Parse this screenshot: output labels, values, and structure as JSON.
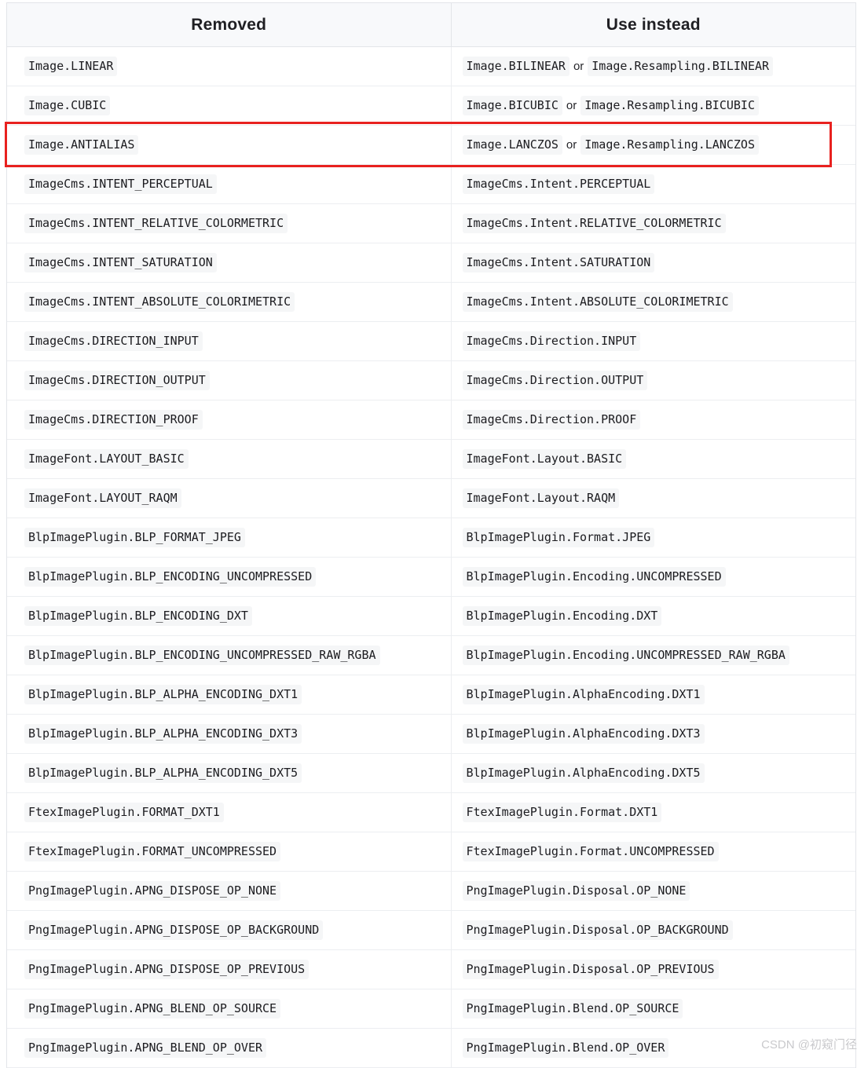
{
  "table": {
    "columns": [
      "Removed",
      "Use instead"
    ],
    "rows": [
      {
        "removed": "Image.LINEAR",
        "instead": [
          "Image.BILINEAR",
          "Image.Resampling.BILINEAR"
        ],
        "separator": "or",
        "highlighted": false
      },
      {
        "removed": "Image.CUBIC",
        "instead": [
          "Image.BICUBIC",
          "Image.Resampling.BICUBIC"
        ],
        "separator": "or",
        "highlighted": false
      },
      {
        "removed": "Image.ANTIALIAS",
        "instead": [
          "Image.LANCZOS",
          "Image.Resampling.LANCZOS"
        ],
        "separator": "or",
        "highlighted": true
      },
      {
        "removed": "ImageCms.INTENT_PERCEPTUAL",
        "instead": [
          "ImageCms.Intent.PERCEPTUAL"
        ],
        "separator": "",
        "highlighted": false
      },
      {
        "removed": "ImageCms.INTENT_RELATIVE_COLORMETRIC",
        "instead": [
          "ImageCms.Intent.RELATIVE_COLORMETRIC"
        ],
        "separator": "",
        "highlighted": false
      },
      {
        "removed": "ImageCms.INTENT_SATURATION",
        "instead": [
          "ImageCms.Intent.SATURATION"
        ],
        "separator": "",
        "highlighted": false
      },
      {
        "removed": "ImageCms.INTENT_ABSOLUTE_COLORIMETRIC",
        "instead": [
          "ImageCms.Intent.ABSOLUTE_COLORIMETRIC"
        ],
        "separator": "",
        "highlighted": false
      },
      {
        "removed": "ImageCms.DIRECTION_INPUT",
        "instead": [
          "ImageCms.Direction.INPUT"
        ],
        "separator": "",
        "highlighted": false
      },
      {
        "removed": "ImageCms.DIRECTION_OUTPUT",
        "instead": [
          "ImageCms.Direction.OUTPUT"
        ],
        "separator": "",
        "highlighted": false
      },
      {
        "removed": "ImageCms.DIRECTION_PROOF",
        "instead": [
          "ImageCms.Direction.PROOF"
        ],
        "separator": "",
        "highlighted": false
      },
      {
        "removed": "ImageFont.LAYOUT_BASIC",
        "instead": [
          "ImageFont.Layout.BASIC"
        ],
        "separator": "",
        "highlighted": false
      },
      {
        "removed": "ImageFont.LAYOUT_RAQM",
        "instead": [
          "ImageFont.Layout.RAQM"
        ],
        "separator": "",
        "highlighted": false
      },
      {
        "removed": "BlpImagePlugin.BLP_FORMAT_JPEG",
        "instead": [
          "BlpImagePlugin.Format.JPEG"
        ],
        "separator": "",
        "highlighted": false
      },
      {
        "removed": "BlpImagePlugin.BLP_ENCODING_UNCOMPRESSED",
        "instead": [
          "BlpImagePlugin.Encoding.UNCOMPRESSED"
        ],
        "separator": "",
        "highlighted": false
      },
      {
        "removed": "BlpImagePlugin.BLP_ENCODING_DXT",
        "instead": [
          "BlpImagePlugin.Encoding.DXT"
        ],
        "separator": "",
        "highlighted": false
      },
      {
        "removed": "BlpImagePlugin.BLP_ENCODING_UNCOMPRESSED_RAW_RGBA",
        "instead": [
          "BlpImagePlugin.Encoding.UNCOMPRESSED_RAW_RGBA"
        ],
        "separator": "",
        "highlighted": false
      },
      {
        "removed": "BlpImagePlugin.BLP_ALPHA_ENCODING_DXT1",
        "instead": [
          "BlpImagePlugin.AlphaEncoding.DXT1"
        ],
        "separator": "",
        "highlighted": false
      },
      {
        "removed": "BlpImagePlugin.BLP_ALPHA_ENCODING_DXT3",
        "instead": [
          "BlpImagePlugin.AlphaEncoding.DXT3"
        ],
        "separator": "",
        "highlighted": false
      },
      {
        "removed": "BlpImagePlugin.BLP_ALPHA_ENCODING_DXT5",
        "instead": [
          "BlpImagePlugin.AlphaEncoding.DXT5"
        ],
        "separator": "",
        "highlighted": false
      },
      {
        "removed": "FtexImagePlugin.FORMAT_DXT1",
        "instead": [
          "FtexImagePlugin.Format.DXT1"
        ],
        "separator": "",
        "highlighted": false
      },
      {
        "removed": "FtexImagePlugin.FORMAT_UNCOMPRESSED",
        "instead": [
          "FtexImagePlugin.Format.UNCOMPRESSED"
        ],
        "separator": "",
        "highlighted": false
      },
      {
        "removed": "PngImagePlugin.APNG_DISPOSE_OP_NONE",
        "instead": [
          "PngImagePlugin.Disposal.OP_NONE"
        ],
        "separator": "",
        "highlighted": false
      },
      {
        "removed": "PngImagePlugin.APNG_DISPOSE_OP_BACKGROUND",
        "instead": [
          "PngImagePlugin.Disposal.OP_BACKGROUND"
        ],
        "separator": "",
        "highlighted": false
      },
      {
        "removed": "PngImagePlugin.APNG_DISPOSE_OP_PREVIOUS",
        "instead": [
          "PngImagePlugin.Disposal.OP_PREVIOUS"
        ],
        "separator": "",
        "highlighted": false
      },
      {
        "removed": "PngImagePlugin.APNG_BLEND_OP_SOURCE",
        "instead": [
          "PngImagePlugin.Blend.OP_SOURCE"
        ],
        "separator": "",
        "highlighted": false
      },
      {
        "removed": "PngImagePlugin.APNG_BLEND_OP_OVER",
        "instead": [
          "PngImagePlugin.Blend.OP_OVER"
        ],
        "separator": "",
        "highlighted": false
      }
    ]
  },
  "annotation": {
    "highlight_color": "#e8211f",
    "highlight_row_index": 2
  },
  "watermark": {
    "text": "CSDN @初窥门径"
  },
  "colors": {
    "header_background": "#f8f9fb",
    "chip_background": "#f5f6f7",
    "border": "#e3e5e9",
    "row_border": "#eceef1",
    "text": "#1b1b1f"
  }
}
